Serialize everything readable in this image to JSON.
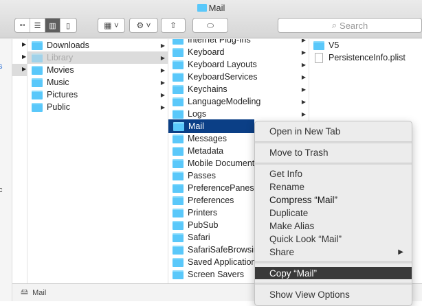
{
  "window": {
    "title": "Mail"
  },
  "toolbar": {
    "view_icons": "icon-view-icon",
    "view_list": "list-view-icon",
    "view_columns": "column-view-icon",
    "view_cover": "cover-flow-icon",
    "search_placeholder": "Search"
  },
  "sidebar": {
    "partial": [
      "s",
      "c"
    ]
  },
  "column2": [
    {
      "name": "Downloads",
      "icon": "downloads-folder"
    },
    {
      "name": "Library",
      "icon": "library-folder",
      "state": "dimmed-selected"
    },
    {
      "name": "Movies",
      "icon": "movies-folder"
    },
    {
      "name": "Music",
      "icon": "music-folder"
    },
    {
      "name": "Pictures",
      "icon": "pictures-folder"
    },
    {
      "name": "Public",
      "icon": "public-folder"
    }
  ],
  "column3": [
    {
      "name": "Internet Plug-Ins",
      "arrow": true
    },
    {
      "name": "Keyboard",
      "arrow": true
    },
    {
      "name": "Keyboard Layouts",
      "arrow": true
    },
    {
      "name": "KeyboardServices",
      "arrow": true
    },
    {
      "name": "Keychains",
      "arrow": true
    },
    {
      "name": "LanguageModeling",
      "arrow": true
    },
    {
      "name": "Logs",
      "arrow": true
    },
    {
      "name": "Mail",
      "arrow": true,
      "selected": true
    },
    {
      "name": "Messages"
    },
    {
      "name": "Metadata"
    },
    {
      "name": "Mobile Documents"
    },
    {
      "name": "Passes"
    },
    {
      "name": "PreferencePanes"
    },
    {
      "name": "Preferences"
    },
    {
      "name": "Printers"
    },
    {
      "name": "PubSub"
    },
    {
      "name": "Safari"
    },
    {
      "name": "SafariSafeBrowsing"
    },
    {
      "name": "Saved Application State"
    },
    {
      "name": "Screen Savers"
    }
  ],
  "column4": [
    {
      "name": "V5",
      "type": "folder"
    },
    {
      "name": "PersistenceInfo.plist",
      "type": "file"
    }
  ],
  "context_menu": {
    "items": [
      "Open in New Tab",
      "Move to Trash",
      "Get Info",
      "Rename",
      "Compress “Mail”",
      "Duplicate",
      "Make Alias",
      "Quick Look “Mail”",
      "Share",
      "Copy “Mail”",
      "Show View Options"
    ],
    "highlighted": "Copy “Mail”"
  },
  "status_bar": {
    "path": "Mail"
  },
  "colors": {
    "selection": "#0b3f86",
    "folder": "#5ac8fa",
    "menu_highlight": "#3a3a3a"
  }
}
